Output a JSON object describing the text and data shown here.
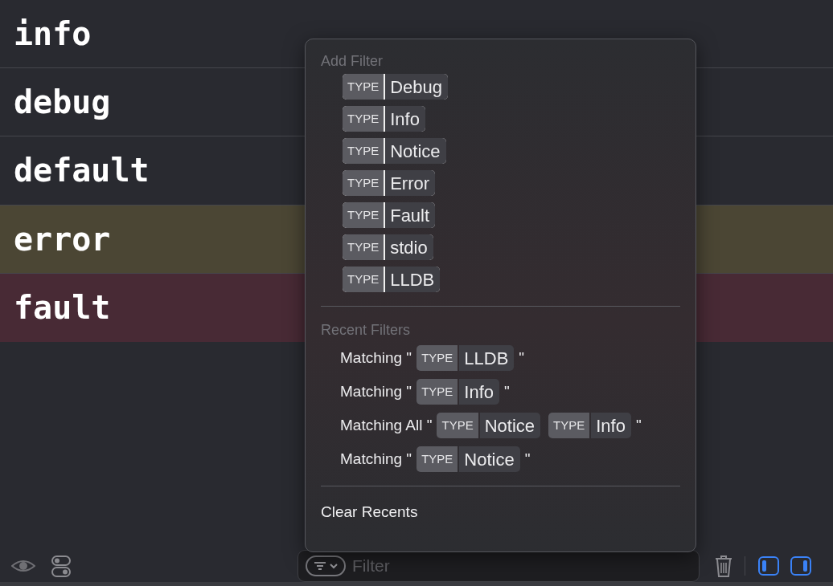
{
  "log_rows": [
    {
      "text": "info",
      "kind": "info"
    },
    {
      "text": "debug",
      "kind": "debug"
    },
    {
      "text": "default",
      "kind": "default"
    },
    {
      "text": "error",
      "kind": "error"
    },
    {
      "text": "fault",
      "kind": "fault"
    }
  ],
  "filter_menu": {
    "add_heading": "Add Filter",
    "add_items": [
      {
        "tag": "TYPE",
        "value": "Debug"
      },
      {
        "tag": "TYPE",
        "value": "Info"
      },
      {
        "tag": "TYPE",
        "value": "Notice"
      },
      {
        "tag": "TYPE",
        "value": "Error"
      },
      {
        "tag": "TYPE",
        "value": "Fault"
      },
      {
        "tag": "TYPE",
        "value": "stdio"
      },
      {
        "tag": "TYPE",
        "value": "LLDB"
      }
    ],
    "recent_heading": "Recent Filters",
    "recent_items": [
      {
        "prefix": "Matching \"",
        "tokens": [
          {
            "tag": "TYPE",
            "value": "LLDB"
          }
        ],
        "suffix": "\""
      },
      {
        "prefix": "Matching \"",
        "tokens": [
          {
            "tag": "TYPE",
            "value": "Info"
          }
        ],
        "suffix": "\""
      },
      {
        "prefix": "Matching All \"",
        "tokens": [
          {
            "tag": "TYPE",
            "value": "Notice"
          },
          {
            "tag": "TYPE",
            "value": "Info"
          }
        ],
        "suffix": "\""
      },
      {
        "prefix": "Matching \"",
        "tokens": [
          {
            "tag": "TYPE",
            "value": "Notice"
          }
        ],
        "suffix": "\""
      }
    ],
    "clear_label": "Clear Recents"
  },
  "bottom_bar": {
    "filter_placeholder": "Filter",
    "left_panel_on": true,
    "right_panel_on": true
  }
}
